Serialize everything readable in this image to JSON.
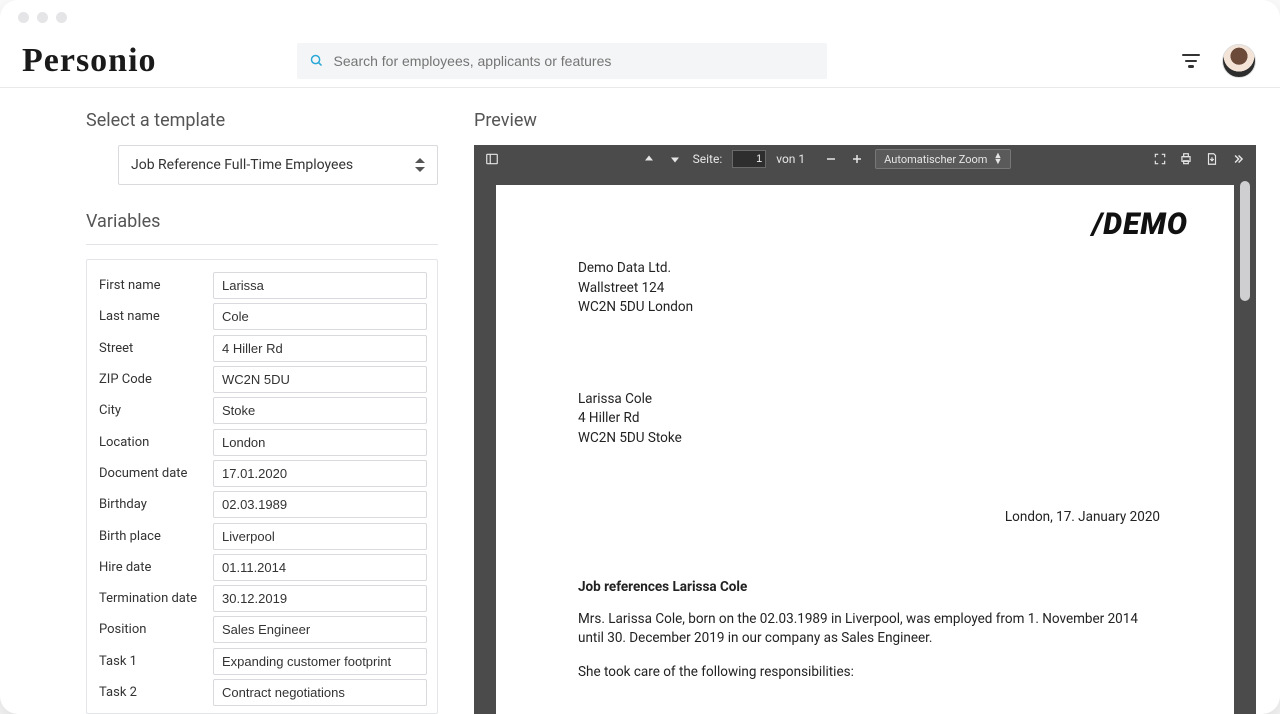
{
  "app": {
    "brand": "Personio"
  },
  "search": {
    "placeholder": "Search for employees, applicants or features"
  },
  "left": {
    "select_template_title": "Select a template",
    "template_selected": "Job Reference Full-Time Employees",
    "variables_title": "Variables",
    "vars": [
      {
        "label": "First name",
        "value": "Larissa"
      },
      {
        "label": "Last name",
        "value": "Cole"
      },
      {
        "label": "Street",
        "value": "4 Hiller Rd"
      },
      {
        "label": "ZIP Code",
        "value": "WC2N 5DU"
      },
      {
        "label": "City",
        "value": "Stoke"
      },
      {
        "label": "Location",
        "value": "London"
      },
      {
        "label": "Document date",
        "value": "17.01.2020"
      },
      {
        "label": "Birthday",
        "value": "02.03.1989"
      },
      {
        "label": "Birth place",
        "value": "Liverpool"
      },
      {
        "label": "Hire date",
        "value": "01.11.2014"
      },
      {
        "label": "Termination date",
        "value": "30.12.2019"
      },
      {
        "label": "Position",
        "value": "Sales Engineer"
      },
      {
        "label": "Task 1",
        "value": "Expanding customer footprint"
      },
      {
        "label": "Task 2",
        "value": "Contract negotiations"
      }
    ]
  },
  "preview": {
    "title": "Preview",
    "toolbar": {
      "page_label": "Seite:",
      "page_current": "1",
      "page_total_label": "von 1",
      "zoom_label": "Automatischer Zoom"
    },
    "doc": {
      "logo": "/DEMO",
      "sender": [
        "Demo Data Ltd.",
        "Wallstreet 124",
        "WC2N 5DU London"
      ],
      "recipient": [
        "Larissa Cole",
        "4 Hiller Rd",
        "WC2N 5DU Stoke"
      ],
      "date_line": "London, 17. January 2020",
      "ref_title": "Job references Larissa Cole",
      "body1": "Mrs. Larissa Cole, born on the 02.03.1989 in Liverpool, was employed from 1. November 2014 until 30. December 2019 in our company as Sales Engineer.",
      "body2": "She took care of the following responsibilities:"
    }
  }
}
